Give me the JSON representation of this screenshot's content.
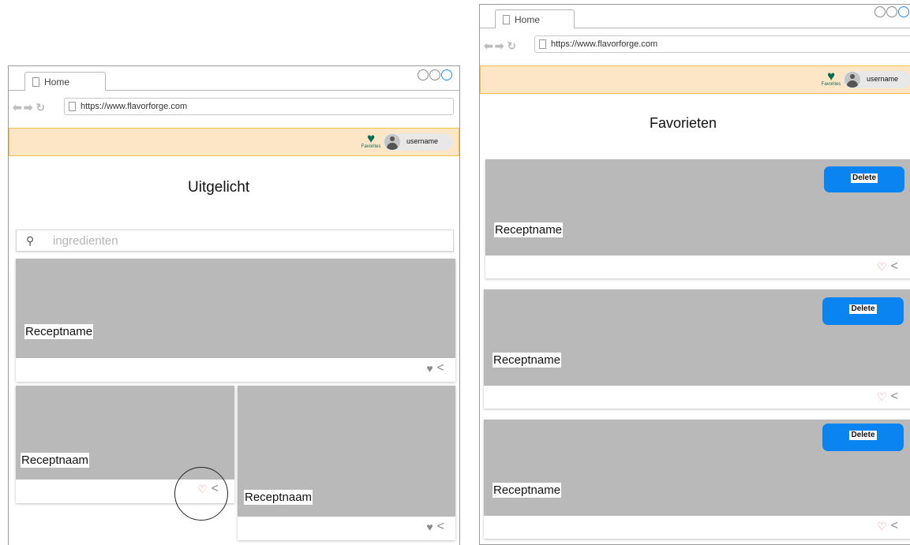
{
  "left_window": {
    "tab_label": "Home",
    "url": "https://www.flavorforge.com",
    "favorites_label": "Favorites",
    "username": "username",
    "page_title": "Uitgelicht",
    "search_placeholder": "ingredienten",
    "cards": [
      {
        "name": "Receptname"
      },
      {
        "name": "Receptnaam"
      },
      {
        "name": "Receptnaam"
      }
    ]
  },
  "right_window": {
    "tab_label": "Home",
    "url": "https://www.flavorforge.com",
    "favorites_label": "Favorites",
    "username": "username",
    "page_title": "Favorieten",
    "cards": [
      {
        "name": "Receptname",
        "delete_label": "Delete"
      },
      {
        "name": "Receptname",
        "delete_label": "Delete"
      },
      {
        "name": "Receptname",
        "delete_label": "Delete"
      }
    ]
  },
  "icons": {
    "heart": "heart-icon",
    "share": "share-icon",
    "search": "search-icon",
    "back": "back-arrow-icon",
    "forward": "forward-arrow-icon",
    "reload": "reload-icon",
    "document": "document-icon",
    "avatar": "user-avatar-icon"
  },
  "colors": {
    "header_bg": "#fde6c5",
    "header_border": "#f0c14b",
    "favorites_green": "#0a6b55",
    "delete_blue": "#0a84f0",
    "image_placeholder": "#b9b9b9",
    "liked_heart": "#e98a8a"
  }
}
